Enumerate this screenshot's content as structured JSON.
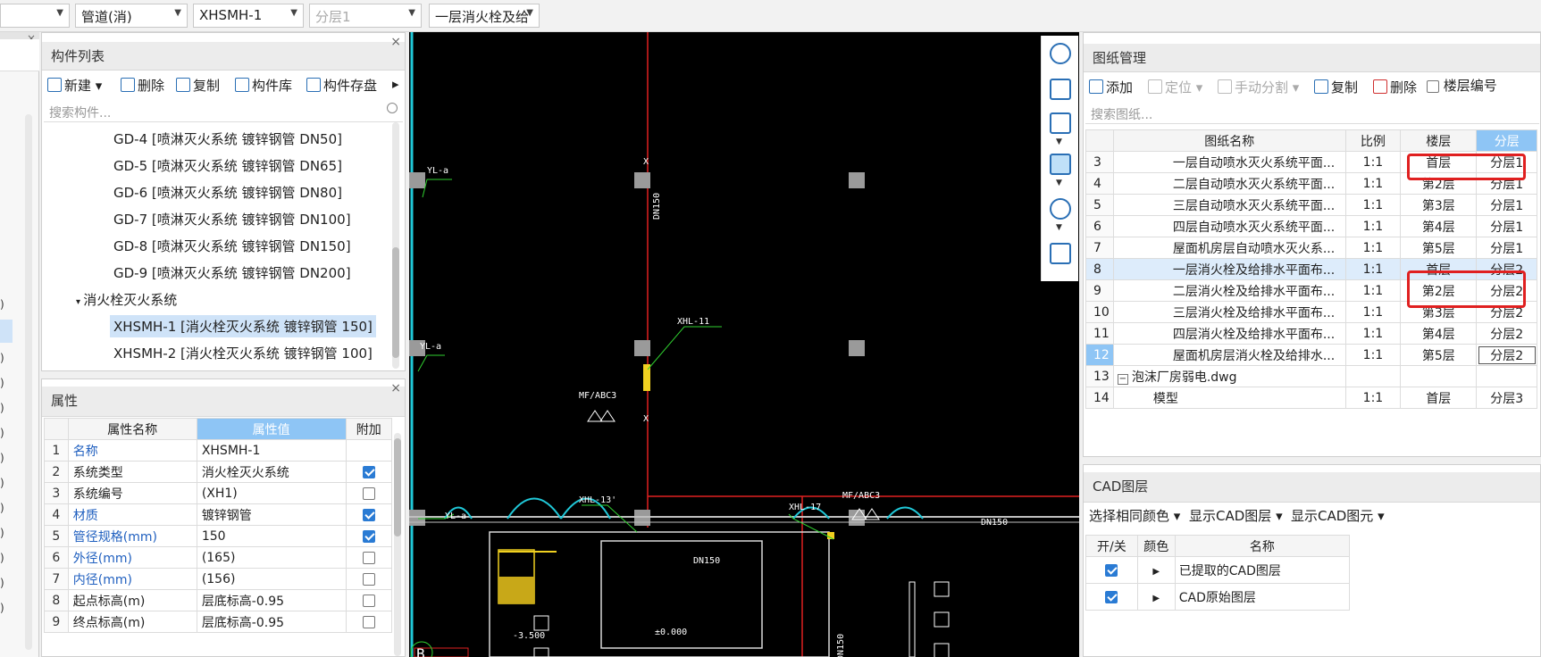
{
  "toolbar": {
    "combos": [
      {
        "value": "",
        "disabled": false
      },
      {
        "value": "管道(消)",
        "disabled": false
      },
      {
        "value": "XHSMH-1",
        "disabled": false
      },
      {
        "value": "分层1",
        "disabled": true
      },
      {
        "value": "一层消火栓及给",
        "disabled": false
      }
    ]
  },
  "component_list": {
    "title": "构件列表",
    "buttons": {
      "new": "新建",
      "delete": "删除",
      "copy": "复制",
      "library": "构件库",
      "save": "构件存盘",
      "more": "▸"
    },
    "search_placeholder": "搜索构件...",
    "items": [
      "GD-4 [喷淋灭火系统 镀锌钢管 DN50]",
      "GD-5 [喷淋灭火系统 镀锌钢管 DN65]",
      "GD-6 [喷淋灭火系统 镀锌钢管 DN80]",
      "GD-7 [喷淋灭火系统 镀锌钢管 DN100]",
      "GD-8 [喷淋灭火系统 镀锌钢管 DN150]",
      "GD-9 [喷淋灭火系统 镀锌钢管 DN200]"
    ],
    "group": "消火栓灭火系统",
    "group_items": [
      "XHSMH-1 [消火栓灭火系统 镀锌钢管 150]",
      "XHSMH-2 [消火栓灭火系统 镀锌钢管 100]"
    ]
  },
  "properties": {
    "title": "属性",
    "headers": {
      "name": "属性名称",
      "value": "属性值",
      "extra": "附加"
    },
    "rows": [
      {
        "n": "1",
        "name": "名称",
        "value": "XHSMH-1",
        "checked": null,
        "blue": true
      },
      {
        "n": "2",
        "name": "系统类型",
        "value": "消火栓灭火系统",
        "checked": true,
        "blue": false
      },
      {
        "n": "3",
        "name": "系统编号",
        "value": "(XH1)",
        "checked": false,
        "blue": false
      },
      {
        "n": "4",
        "name": "材质",
        "value": "镀锌钢管",
        "checked": true,
        "blue": true
      },
      {
        "n": "5",
        "name": "管径规格(mm)",
        "value": "150",
        "checked": true,
        "blue": true
      },
      {
        "n": "6",
        "name": "外径(mm)",
        "value": "(165)",
        "checked": false,
        "blue": true
      },
      {
        "n": "7",
        "name": "内径(mm)",
        "value": "(156)",
        "checked": false,
        "blue": true
      },
      {
        "n": "8",
        "name": "起点标高(m)",
        "value": "层底标高-0.95",
        "checked": false,
        "blue": false
      },
      {
        "n": "9",
        "name": "终点标高(m)",
        "value": "层底标高-0.95",
        "checked": false,
        "blue": false
      }
    ]
  },
  "cad_labels": {
    "yl": "YL-a",
    "xhl11": "XHL-11",
    "xhl13": "XHL-13'",
    "xhl17": "XHL-17",
    "mf": "MF/ABC3",
    "dn150": "DN150",
    "elev1": "-3.500",
    "elev2": "±0.000",
    "b": "B"
  },
  "drawings": {
    "title": "图纸管理",
    "buttons": {
      "add": "添加",
      "locate": "定位",
      "split": "手动分割",
      "copy": "复制",
      "delete": "删除",
      "floor_no": "楼层编号"
    },
    "search_placeholder": "搜索图纸...",
    "headers": {
      "name": "图纸名称",
      "scale": "比例",
      "floor": "楼层",
      "layer": "分层"
    },
    "rows": [
      {
        "n": "3",
        "name": "一层自动喷水灭火系统平面...",
        "scale": "1:1",
        "floor": "首层",
        "layer": "分层1",
        "indent": 2
      },
      {
        "n": "4",
        "name": "二层自动喷水灭火系统平面...",
        "scale": "1:1",
        "floor": "第2层",
        "layer": "分层1",
        "indent": 2
      },
      {
        "n": "5",
        "name": "三层自动喷水灭火系统平面...",
        "scale": "1:1",
        "floor": "第3层",
        "layer": "分层1",
        "indent": 2
      },
      {
        "n": "6",
        "name": "四层自动喷水灭火系统平面...",
        "scale": "1:1",
        "floor": "第4层",
        "layer": "分层1",
        "indent": 2
      },
      {
        "n": "7",
        "name": "屋面机房层自动喷水灭火系...",
        "scale": "1:1",
        "floor": "第5层",
        "layer": "分层1",
        "indent": 2
      },
      {
        "n": "8",
        "name": "一层消火栓及给排水平面布...",
        "scale": "1:1",
        "floor": "首层",
        "layer": "分层2",
        "indent": 2
      },
      {
        "n": "9",
        "name": "二层消火栓及给排水平面布...",
        "scale": "1:1",
        "floor": "第2层",
        "layer": "分层2",
        "indent": 2
      },
      {
        "n": "10",
        "name": "三层消火栓及给排水平面布...",
        "scale": "1:1",
        "floor": "第3层",
        "layer": "分层2",
        "indent": 2
      },
      {
        "n": "11",
        "name": "四层消火栓及给排水平面布...",
        "scale": "1:1",
        "floor": "第4层",
        "layer": "分层2",
        "indent": 2
      },
      {
        "n": "12",
        "name": "屋面机房层消火栓及给排水...",
        "scale": "1:1",
        "floor": "第5层",
        "layer": "分层2",
        "indent": 2
      },
      {
        "n": "13",
        "name": "泡沫厂房弱电.dwg",
        "scale": "",
        "floor": "",
        "layer": "",
        "indent": 0
      },
      {
        "n": "14",
        "name": "模型",
        "scale": "1:1",
        "floor": "首层",
        "layer": "分层3",
        "indent": 1
      }
    ]
  },
  "cad_layers": {
    "title": "CAD图层",
    "buttons": {
      "same_color": "选择相同颜色",
      "show_layer": "显示CAD图层",
      "show_element": "显示CAD图元"
    },
    "headers": {
      "toggle": "开/关",
      "color": "颜色",
      "name": "名称"
    },
    "rows": [
      {
        "name": "已提取的CAD图层",
        "on": true
      },
      {
        "name": "CAD原始图层",
        "on": true
      }
    ]
  },
  "left_strip_chars": [
    ")",
    ")",
    ")",
    ")",
    ")",
    ")",
    ")",
    ")",
    ")",
    ")",
    ")",
    ")"
  ]
}
